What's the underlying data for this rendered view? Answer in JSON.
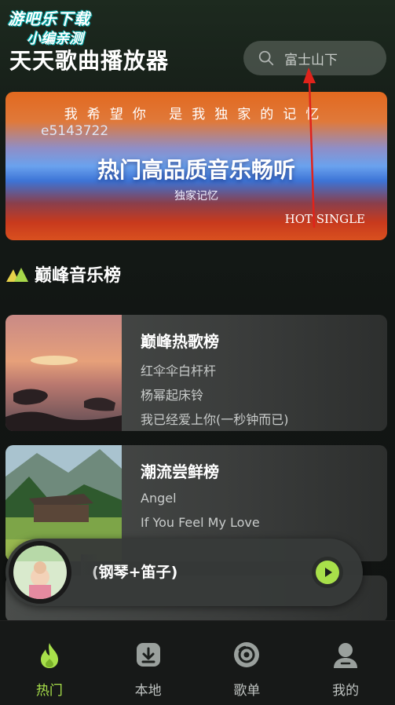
{
  "watermark": {
    "line1": "游吧乐下载",
    "line2": "小编亲测"
  },
  "header": {
    "app_title": "天天歌曲播放器"
  },
  "search": {
    "placeholder": "富士山下"
  },
  "banner": {
    "top_line": "我希望你 是我独家的记忆",
    "code": "e5143722",
    "headline": "热门高品质音乐畅听",
    "subtitle": "独家记忆",
    "tag": "HOT SINGLE"
  },
  "section": {
    "title": "巅峰音乐榜",
    "icon": "mountain-icon"
  },
  "charts": [
    {
      "name": "巅峰热歌榜",
      "songs": [
        "红伞伞白杆杆",
        "杨幂起床铃",
        "我已经爱上你(一秒钟而已)"
      ]
    },
    {
      "name": "潮流尝鲜榜",
      "songs": [
        "Angel",
        "If You Feel My Love"
      ]
    }
  ],
  "player": {
    "track": "(钢琴+笛子)",
    "play_icon": "play-icon"
  },
  "tabs": [
    {
      "label": "热门",
      "icon": "fire-icon",
      "active": true
    },
    {
      "label": "本地",
      "icon": "download-icon",
      "active": false
    },
    {
      "label": "歌单",
      "icon": "disc-icon",
      "active": false
    },
    {
      "label": "我的",
      "icon": "user-icon",
      "active": false
    }
  ],
  "colors": {
    "accent": "#a8e04a",
    "background": "#121614",
    "arrow": "#e0231b"
  }
}
